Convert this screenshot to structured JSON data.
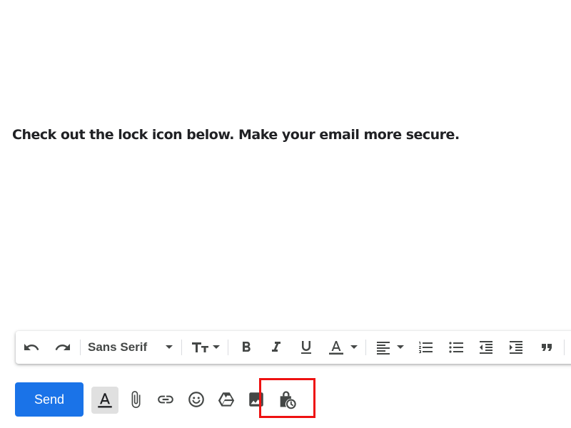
{
  "email": {
    "body_text": "Check out the lock icon below. Make your email more secure."
  },
  "toolbar": {
    "undo": "undo-icon",
    "redo": "redo-icon",
    "font_family": "Sans Serif",
    "font_size": "text-size-icon",
    "bold": "bold-icon",
    "italic": "italic-icon",
    "underline": "underline-icon",
    "text_color": "text-color-icon",
    "align": "align-icon",
    "numbered_list": "numbered-list-icon",
    "bulleted_list": "bulleted-list-icon",
    "indent_less": "indent-less-icon",
    "indent_more": "indent-more-icon",
    "quote": "quote-icon"
  },
  "bottom_bar": {
    "send_label": "Send",
    "icons": [
      "formatting-options-icon",
      "attach-icon",
      "link-icon",
      "emoji-icon",
      "google-drive-icon",
      "insert-photo-icon",
      "confidential-mode-icon"
    ]
  },
  "colors": {
    "send_button": "#1a73e8",
    "highlight_box": "#ee1111",
    "icon_gray": "#444746",
    "body_text": "#202124"
  }
}
